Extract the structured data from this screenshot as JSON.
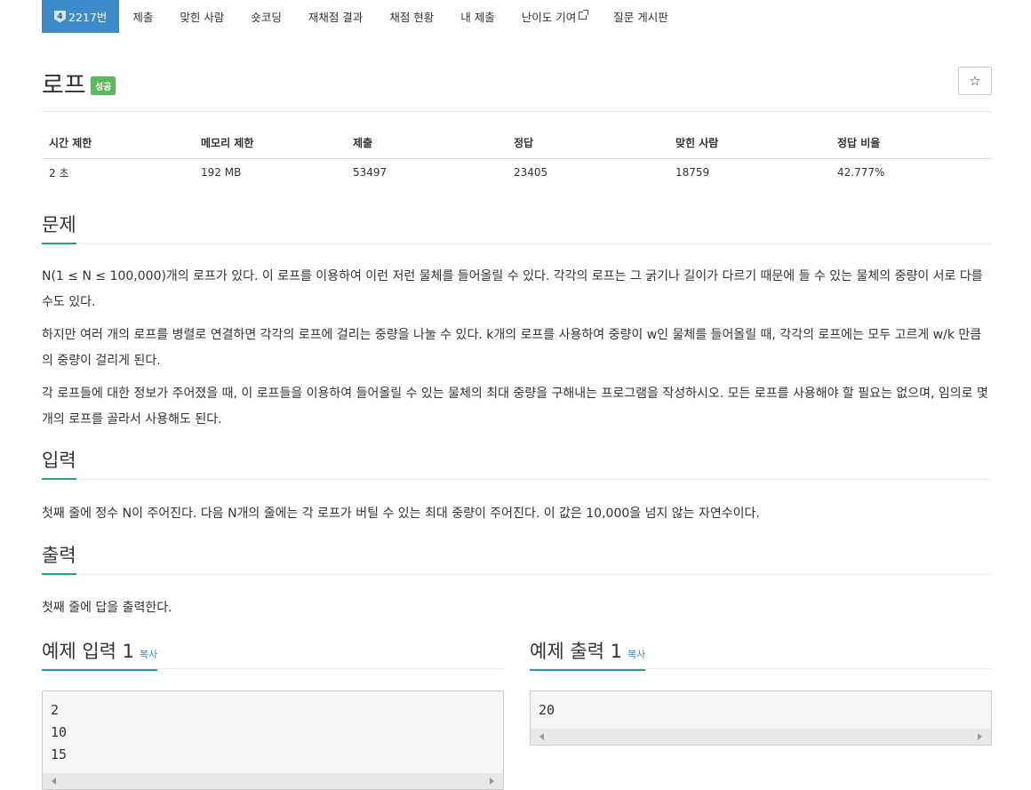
{
  "nav": {
    "problem_id": "2217번",
    "tier_label": "4",
    "items": [
      "제출",
      "맞힌 사람",
      "숏코딩",
      "재채점 결과",
      "채점 현황",
      "내 제출",
      "난이도 기여",
      "질문 게시판"
    ]
  },
  "problem": {
    "title": "로프",
    "badge": "성공",
    "star": "☆"
  },
  "info": {
    "headers": [
      "시간 제한",
      "메모리 제한",
      "제출",
      "정답",
      "맞힌 사람",
      "정답 비율"
    ],
    "values": [
      "2 초",
      "192 MB",
      "53497",
      "23405",
      "18759",
      "42.777%"
    ]
  },
  "description": {
    "heading": "문제",
    "paragraphs": [
      "N(1 ≤ N ≤ 100,000)개의 로프가 있다. 이 로프를 이용하여 이런 저런 물체를 들어올릴 수 있다. 각각의 로프는 그 굵기나 길이가 다르기 때문에 들 수 있는 물체의 중량이 서로 다를 수도 있다.",
      "하지만 여러 개의 로프를 병렬로 연결하면 각각의 로프에 걸리는 중량을 나눌 수 있다. k개의 로프를 사용하여 중량이 w인 물체를 들어올릴 때, 각각의 로프에는 모두 고르게 w/k 만큼의 중량이 걸리게 된다.",
      "각 로프들에 대한 정보가 주어졌을 때, 이 로프들을 이용하여 들어올릴 수 있는 물체의 최대 중량을 구해내는 프로그램을 작성하시오. 모든 로프를 사용해야 할 필요는 없으며, 임의로 몇 개의 로프를 골라서 사용해도 된다."
    ]
  },
  "input": {
    "heading": "입력",
    "text": "첫째 줄에 정수 N이 주어진다. 다음 N개의 줄에는 각 로프가 버틸 수 있는 최대 중량이 주어진다. 이 값은 10,000을 넘지 않는 자연수이다."
  },
  "output": {
    "heading": "출력",
    "text": "첫째 줄에 답을 출력한다."
  },
  "samples": {
    "input_heading": "예제 입력 1",
    "output_heading": "예제 출력 1",
    "copy_label": "복사",
    "input_text": "2\n10\n15",
    "output_text": "20"
  }
}
